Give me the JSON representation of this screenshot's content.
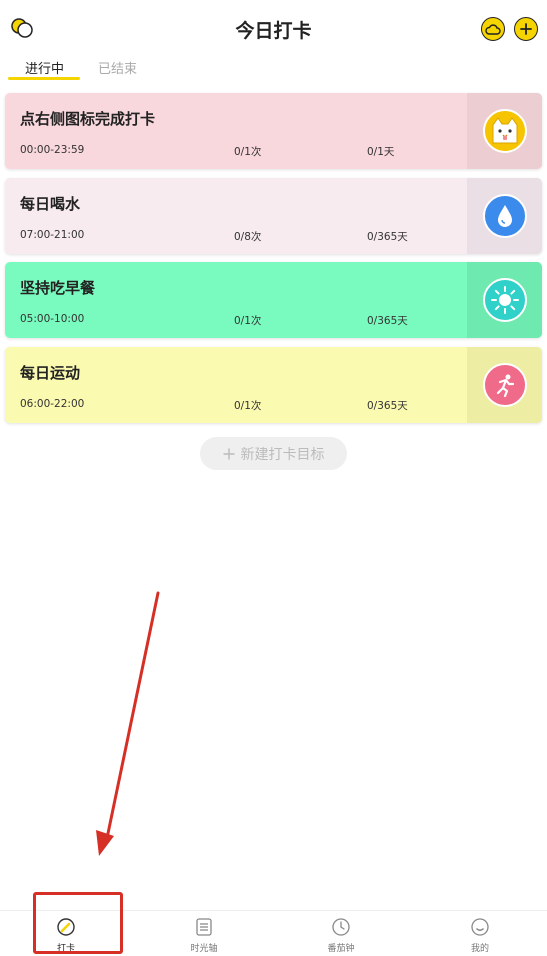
{
  "header": {
    "title": "今日打卡",
    "icons": {
      "left": "app-logo-icon",
      "cloud": "cloud-icon",
      "add": "plus-icon"
    }
  },
  "tabs": [
    {
      "label": "进行中",
      "active": true
    },
    {
      "label": "已结束",
      "active": false
    }
  ],
  "cards": [
    {
      "title": "点右侧图标完成打卡",
      "time": "00:00-23:59",
      "count": "0/1次",
      "days": "0/1天",
      "bg": "#f8d7dd",
      "side": "#ebcdd2",
      "icon": "cat-face-icon",
      "icon_color": "#f6c400"
    },
    {
      "title": "每日喝水",
      "time": "07:00-21:00",
      "count": "0/8次",
      "days": "0/365天",
      "bg": "#f7ebf0",
      "side": "#eadfe4",
      "icon": "water-drop-icon",
      "icon_color": "#3b8bec"
    },
    {
      "title": "坚持吃早餐",
      "time": "05:00-10:00",
      "count": "0/1次",
      "days": "0/365天",
      "bg": "#79fbbf",
      "side": "#6ee9af",
      "icon": "sun-icon",
      "icon_color": "#2fd1c8"
    },
    {
      "title": "每日运动",
      "time": "06:00-22:00",
      "count": "0/1次",
      "days": "0/365天",
      "bg": "#fbfab1",
      "side": "#ededa4",
      "icon": "running-icon",
      "icon_color": "#f06b89"
    }
  ],
  "new_goal": {
    "label": "新建打卡目标",
    "icon": "plus-icon"
  },
  "tabbar": [
    {
      "label": "打卡",
      "icon": "checkin-icon",
      "active": true
    },
    {
      "label": "时光轴",
      "icon": "timeline-icon",
      "active": false
    },
    {
      "label": "番茄钟",
      "icon": "clock-icon",
      "active": false
    },
    {
      "label": "我的",
      "icon": "profile-icon",
      "active": false
    }
  ],
  "colors": {
    "accent": "#f6d400",
    "annotation": "#d63026"
  }
}
